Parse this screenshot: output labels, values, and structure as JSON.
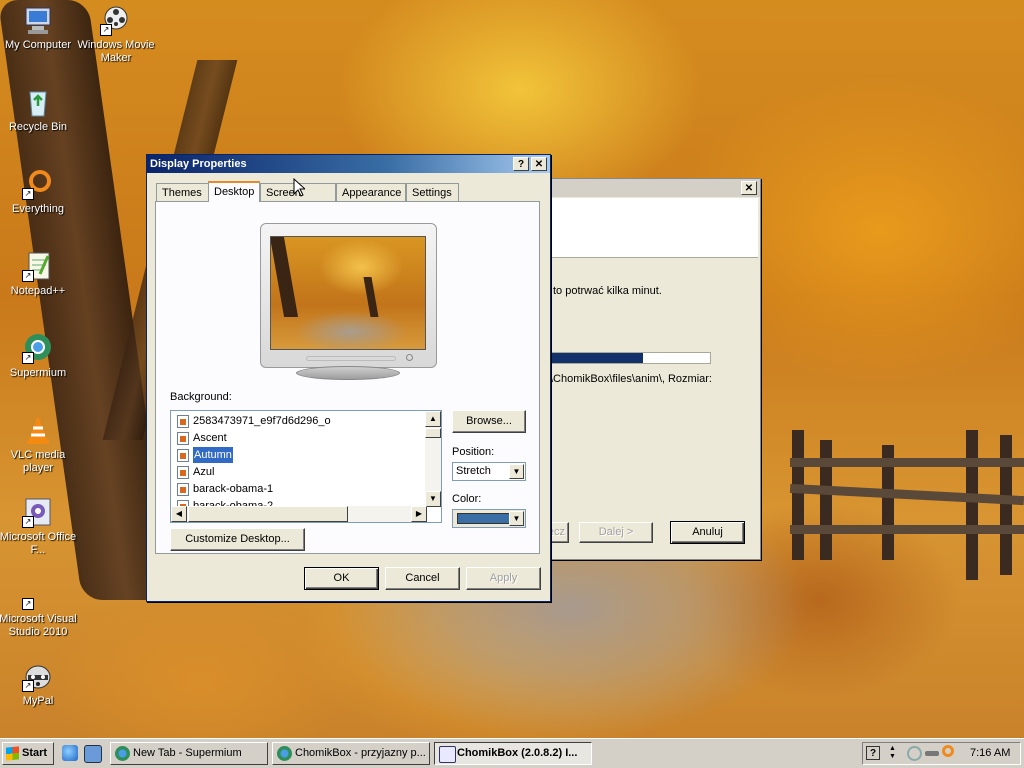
{
  "desktop_icons": [
    {
      "label": "My Computer"
    },
    {
      "label": "Windows Movie Maker"
    },
    {
      "label": "Recycle Bin"
    },
    {
      "label": "Everything"
    },
    {
      "label": "Notepad++"
    },
    {
      "label": "Supermium"
    },
    {
      "label": "VLC media player"
    },
    {
      "label": "Microsoft Office F..."
    },
    {
      "label": "Microsoft Visual Studio 2010"
    },
    {
      "label": "MyPal"
    }
  ],
  "display_properties": {
    "title": "Display Properties",
    "help_glyph": "?",
    "close_glyph": "✕",
    "tabs": [
      "Themes",
      "Desktop",
      "Screen Saver",
      "Appearance",
      "Settings"
    ],
    "selected_tab": "Desktop",
    "background_label": "Background:",
    "background_items": [
      "2583473971_e9f7d6d296_o",
      "Ascent",
      "Autumn",
      "Azul",
      "barack-obama-1",
      "barack-obama-2"
    ],
    "selected_background": "Autumn",
    "browse_label": "Browse...",
    "position_label": "Position:",
    "position_value": "Stretch",
    "color_label": "Color:",
    "color_value": "#3a6ea5",
    "customize_label": "Customize Desktop...",
    "ok_label": "OK",
    "cancel_label": "Cancel",
    "apply_label": "Apply"
  },
  "chomikbox_window": {
    "close_glyph": "✕",
    "status_text": "to potrwać kilka minut.",
    "progress": 0.58,
    "path_text": "\\ChomikBox\\files\\anim\\, Rozmiar:",
    "back_label": "ecz",
    "next_label": "Dalej >",
    "cancel_label": "Anuluj"
  },
  "taskbar": {
    "start_label": "Start",
    "tasks": [
      {
        "label": "New Tab - Supermium",
        "active": false
      },
      {
        "label": "ChomikBox - przyjazny p...",
        "active": false
      },
      {
        "label": "ChomikBox (2.0.8.2) I...",
        "active": true
      }
    ],
    "clock": "7:16 AM",
    "help_glyph": "?"
  },
  "colors": {
    "title_active": "#0a246a",
    "selection": "#316ac5",
    "tab_highlight": "#e68b2c"
  }
}
